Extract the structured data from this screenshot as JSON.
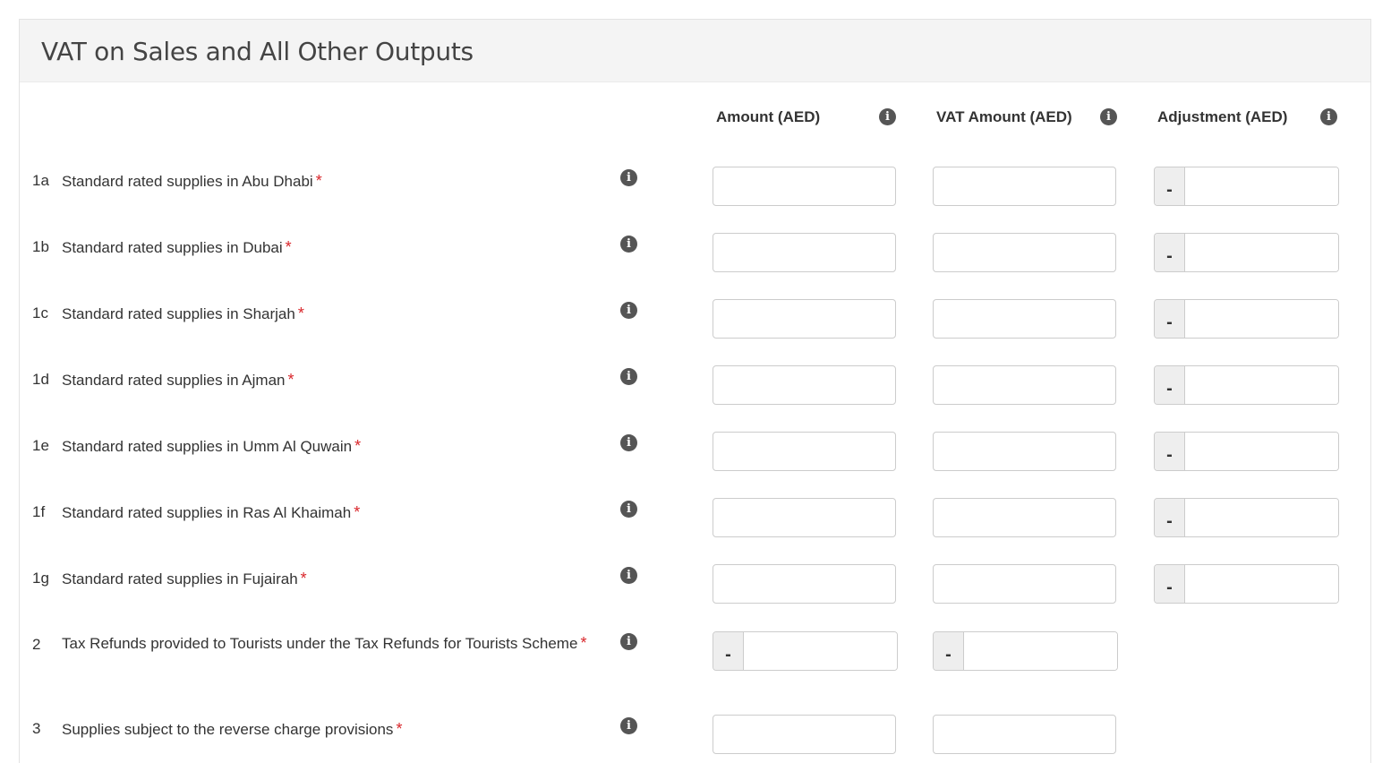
{
  "panel": {
    "title": "VAT on Sales and All Other Outputs"
  },
  "columns": {
    "amount": "Amount (AED)",
    "vat_amount": "VAT Amount (AED)",
    "adjustment": "Adjustment (AED)"
  },
  "required_marker": "*",
  "adjustment_prefix": "-",
  "rows": [
    {
      "num": "1a",
      "label": "Standard rated supplies in Abu Dhabi",
      "amount": "",
      "vat_amount": "",
      "adjustment": ""
    },
    {
      "num": "1b",
      "label": "Standard rated supplies in Dubai",
      "amount": "",
      "vat_amount": "",
      "adjustment": ""
    },
    {
      "num": "1c",
      "label": "Standard rated supplies in Sharjah",
      "amount": "",
      "vat_amount": "",
      "adjustment": ""
    },
    {
      "num": "1d",
      "label": "Standard rated supplies in Ajman",
      "amount": "",
      "vat_amount": "",
      "adjustment": ""
    },
    {
      "num": "1e",
      "label": "Standard rated supplies in Umm Al Quwain",
      "amount": "",
      "vat_amount": "",
      "adjustment": ""
    },
    {
      "num": "1f",
      "label": "Standard rated supplies in Ras Al Khaimah",
      "amount": "",
      "vat_amount": "",
      "adjustment": ""
    },
    {
      "num": "1g",
      "label": "Standard rated supplies in Fujairah",
      "amount": "",
      "vat_amount": "",
      "adjustment": ""
    },
    {
      "num": "2",
      "label": "Tax Refunds provided to Tourists under the Tax Refunds for Tourists Scheme",
      "amount": "",
      "vat_amount": ""
    },
    {
      "num": "3",
      "label": "Supplies subject to the reverse charge provisions",
      "amount": "",
      "vat_amount": ""
    }
  ],
  "icons": {
    "info": "info-icon",
    "info_glyph": "i"
  }
}
